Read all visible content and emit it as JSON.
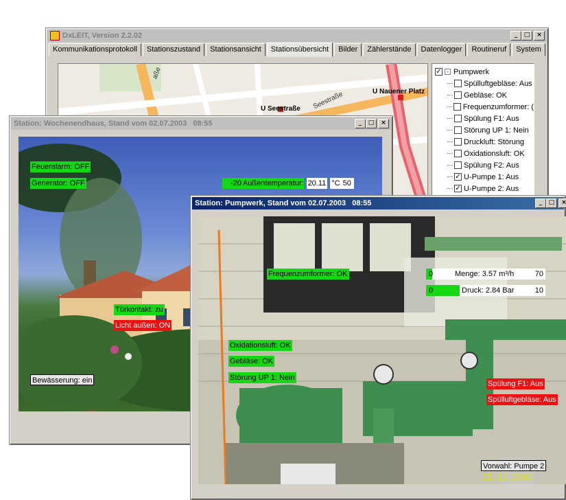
{
  "main_window": {
    "title": "DxLEIT, Version 2.2.02",
    "tabs": [
      "Kommunikationsprotokoll",
      "Stationszustand",
      "Stationsansicht",
      "Stationsübersicht",
      "Bilder",
      "Zählerstände",
      "Datenlogger",
      "Routineruf",
      "System"
    ],
    "selected_tab": "Stationsübersicht",
    "map_labels": {
      "street1": "Seestraße",
      "street2": "U Seestraße",
      "street3": "U Nauener Platz",
      "street4": "aße"
    },
    "tree": {
      "root": "Pumpwerk",
      "items": [
        {
          "label": "Spülluftgebläse: Aus",
          "checked": false
        },
        {
          "label": "Gebläse: OK",
          "checked": false
        },
        {
          "label": "Frequenzumformer: (",
          "checked": false
        },
        {
          "label": "Spülung F1: Aus",
          "checked": false
        },
        {
          "label": "Störung UP 1: Nein",
          "checked": false
        },
        {
          "label": "Druckluft: Störung",
          "checked": false
        },
        {
          "label": "Oxidationsluft: OK",
          "checked": false
        },
        {
          "label": "Spülung F2: Aus",
          "checked": false
        },
        {
          "label": "U-Pumpe 1: Aus",
          "checked": true
        },
        {
          "label": "U-Pumpe 2: Aus",
          "checked": true
        }
      ]
    }
  },
  "window_wochenendhaus": {
    "title": "Station: Wochenendhaus, Stand vom 02.07.2003   08:55",
    "labels": {
      "feueralarm": "Feueralarm: OFF",
      "generator": "Generator: OFF",
      "temp_min": "-20",
      "temp_label": "Außentemperatur:",
      "temp_value": "20.11",
      "temp_unit": "°C",
      "temp_max": "50",
      "tuerkontakt": "Türkontakt: zu",
      "licht": "Licht außen: ON",
      "bewaesserung": "Bewässerung: ein"
    }
  },
  "window_pumpwerk": {
    "title": "Station: Pumpwerk, Stand vom 02.07.2003   08:55",
    "labels": {
      "frequenzumformer": "Frequenzumformer: OK",
      "oxidationsluft": "Oxidationsluft: OK",
      "geblaese": "Gebläse: OK",
      "stoerung": "Störung UP 1: Nein",
      "spuelung_f1": "Spülung F1: Aus",
      "spuelluft": "Spülluftgebläse: Aus",
      "vorwahl": "Vorwahl: Pumpe 2"
    },
    "menge": {
      "min": "0",
      "label": "Menge: 3.57 m³/h",
      "max": "70",
      "fill_fraction": 0.05
    },
    "druck": {
      "min": "0",
      "label": "Druck: 2.84 Bar",
      "max": "10",
      "fill_fraction": 0.28
    },
    "photo_stamp": "21.11.2002"
  },
  "colors": {
    "ok": "#14d814",
    "alarm": "#ee1111",
    "title_active": "#0a246a"
  }
}
